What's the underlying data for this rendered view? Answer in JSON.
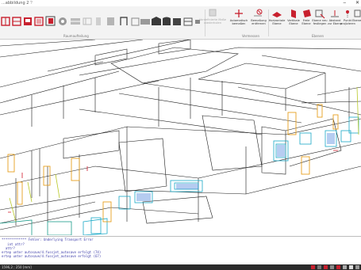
{
  "app": {
    "title": "...abbildung 2",
    "menu_mark": "?"
  },
  "window_controls": {
    "minimize": "–",
    "close": "✕"
  },
  "ribbon": {
    "group_left_label": "Raumaufteilung",
    "group_mid_label": "Vermessen",
    "group_right_label": "Ebenen",
    "disabled_button_label": "Vordefinierte Maße wiederholen",
    "buttons": [
      {
        "label": "Automatisch\nbemaßen"
      },
      {
        "label": "Bemaßung\nentfernen"
      },
      {
        "label": "Horizontale\nEbene"
      },
      {
        "label": "Vertikale\nEbene"
      },
      {
        "label": "Freie\nEbene"
      },
      {
        "label": "Ebene neu\nfestlegen"
      },
      {
        "label": "Abstand\nzur Ebene"
      },
      {
        "label": "Punkt\nprojizieren"
      },
      {
        "label": "Ebene ein/aus"
      }
    ]
  },
  "console": {
    "lines": [
      "************* Fehler: Underlying Transport Error",
      "   int attr?",
      "  attr?",
      "ertep unter autosave/4.fussjet_autosave erfolgt (74)",
      "ertep unter autosave/4.fussjet_autosave erfolgt (67)"
    ]
  },
  "status": {
    "coord_text": "1596,2 ; 250 [mm]"
  },
  "colors": {
    "accent": "#d11a2a",
    "ribbon_bg": "#f3f3f3",
    "status_bg": "#2b2b2b",
    "wire_orange": "#e6a020",
    "wire_cyan": "#1aa9c7"
  }
}
